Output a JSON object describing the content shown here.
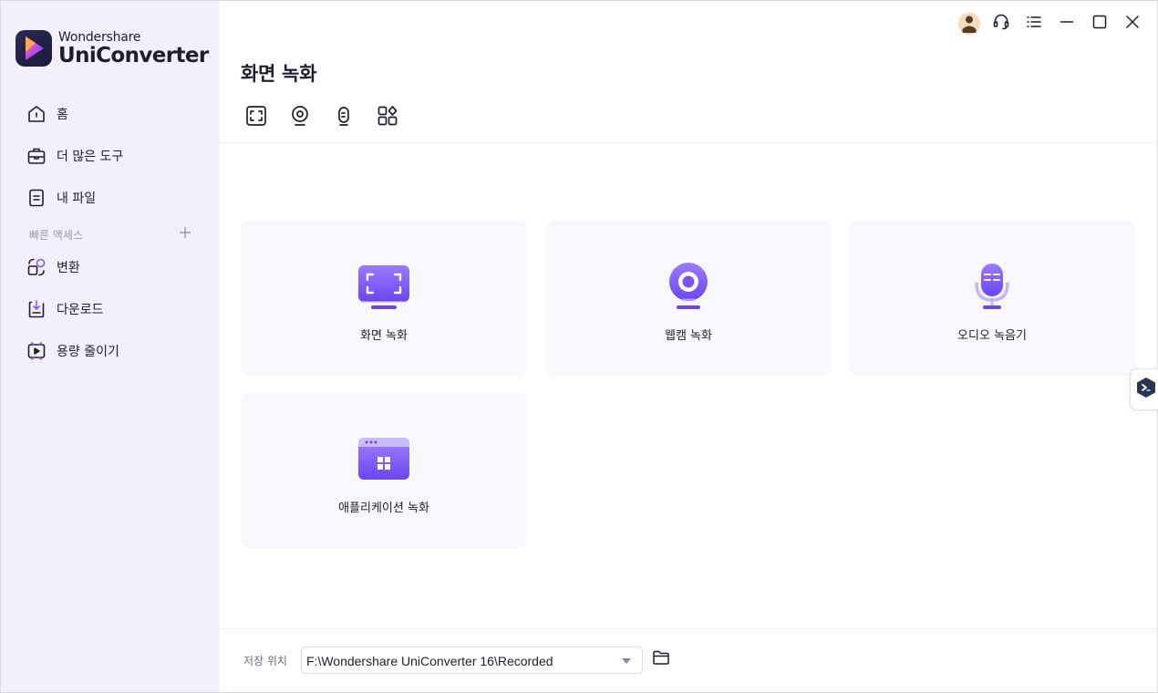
{
  "app": {
    "brand": "Wondershare",
    "product": "UniConverter"
  },
  "sidebar": {
    "items": [
      {
        "label": "홈",
        "icon": "home-icon"
      },
      {
        "label": "더 많은 도구",
        "icon": "toolbox-icon"
      },
      {
        "label": "내 파일",
        "icon": "file-icon"
      }
    ],
    "quick_access_label": "빠른 액세스",
    "quick_items": [
      {
        "label": "변환",
        "icon": "convert-icon"
      },
      {
        "label": "다운로드",
        "icon": "download-icon"
      },
      {
        "label": "용량 줄이기",
        "icon": "compress-icon"
      }
    ]
  },
  "main": {
    "title": "화면 녹화",
    "cards": [
      {
        "label": "화면 녹화",
        "icon": "screen-record-icon"
      },
      {
        "label": "웹캠 녹화",
        "icon": "webcam-record-icon"
      },
      {
        "label": "오디오 녹음기",
        "icon": "audio-recorder-icon"
      },
      {
        "label": "애플리케이션 녹화",
        "icon": "app-record-icon"
      }
    ]
  },
  "footer": {
    "save_label": "저장 위치",
    "save_path": "F:\\Wondershare UniConverter 16\\Recorded"
  },
  "colors": {
    "accent": "#7b5cf5",
    "accent_light": "#b8a6ff",
    "sidebar_bg": "#f3f0fb",
    "card_bg": "#f8f7fc"
  }
}
